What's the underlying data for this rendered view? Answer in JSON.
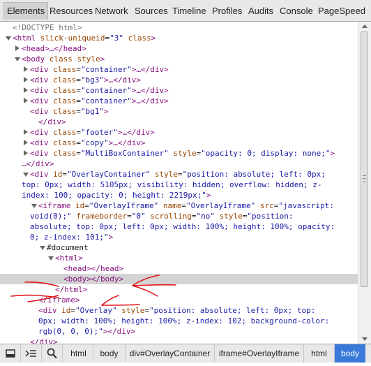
{
  "tabs": [
    "Elements",
    "Resources",
    "Network",
    "Sources",
    "Timeline",
    "Profiles",
    "Audits",
    "Console",
    "PageSpeed"
  ],
  "active_tab": "Elements",
  "tree": {
    "doctype": "<!DOCTYPE html>",
    "html_open": "<html",
    "html_attr": "slick-uniqueid",
    "html_val": "\"3\"",
    "html_class": "class",
    "head_collapsed": "<head>…</head>",
    "body_open": "<body",
    "body_attrs": "class style",
    "div_open": "<div",
    "class_attr": "class",
    "container": "\"container\"",
    "bg3": "\"bg3\"",
    "bg1": "\"bg1\"",
    "footer": "\"footer\"",
    "copy": "\"copy\"",
    "multibox": "\"MultiBoxContainer\"",
    "collapsed_tail": ">…</div>",
    "close_gt": ">",
    "close_div": "</div>",
    "ellipsis_div": "…</div>",
    "style_attr": "style",
    "multibox_style": "\"opacity: 0; display: none;\"",
    "multibox_tail": ">",
    "id_attr": "id",
    "overlay_container": "\"OverlayContainer\"",
    "oc_style_1": "\"position: absolute; left: 0px;",
    "oc_style_2": "top: 0px; width: 5105px; visibility: hidden; overflow: hidden; z-",
    "oc_style_3": "index: 100; opacity: 0; height: 2219px;\"",
    "iframe_open": "<iframe",
    "overlay_iframe": "\"OverlayIframe\"",
    "name_attr": "name",
    "src_attr": "src",
    "src_val_1": "\"javascript:",
    "src_val_2": "void(0);\"",
    "frameborder_attr": "frameborder",
    "zero": "\"0\"",
    "scrolling_attr": "scrolling",
    "no": "\"no\"",
    "if_style_1": "\"position:",
    "if_style_2": "absolute; top: 0px; left: 0px; width: 100%; height: 100%; opacity:",
    "if_style_3": "0; z-index: 101;\"",
    "document": "#document",
    "html_tag": "<html>",
    "head_empty": "<head></head>",
    "body_empty": "<body></body>",
    "html_close": "</html>",
    "iframe_close": "</iframe>",
    "overlay": "\"Overlay\"",
    "ov_style_1": "\"position: absolute; left: 0px; top:",
    "ov_style_2": "0px; width: 100%; height: 100%; z-index: 102; background-color:",
    "ov_style_3": "rgb(0, 0, 0);\"",
    "ov_tail": "></div>"
  },
  "breadcrumbs": [
    "html",
    "body",
    "div#OverlayContainer",
    "iframe#OverlayIframe",
    "html",
    "body"
  ],
  "selected_crumb": "body",
  "icons": [
    "dock-icon",
    "console-toggle-icon",
    "inspect-search-icon"
  ],
  "colors": {
    "tag": "#881280",
    "attr_name": "#994500",
    "attr_value": "#1a1aa6",
    "selected_crumb": "#3879d9",
    "annotation_arrows": "#e0171c"
  }
}
